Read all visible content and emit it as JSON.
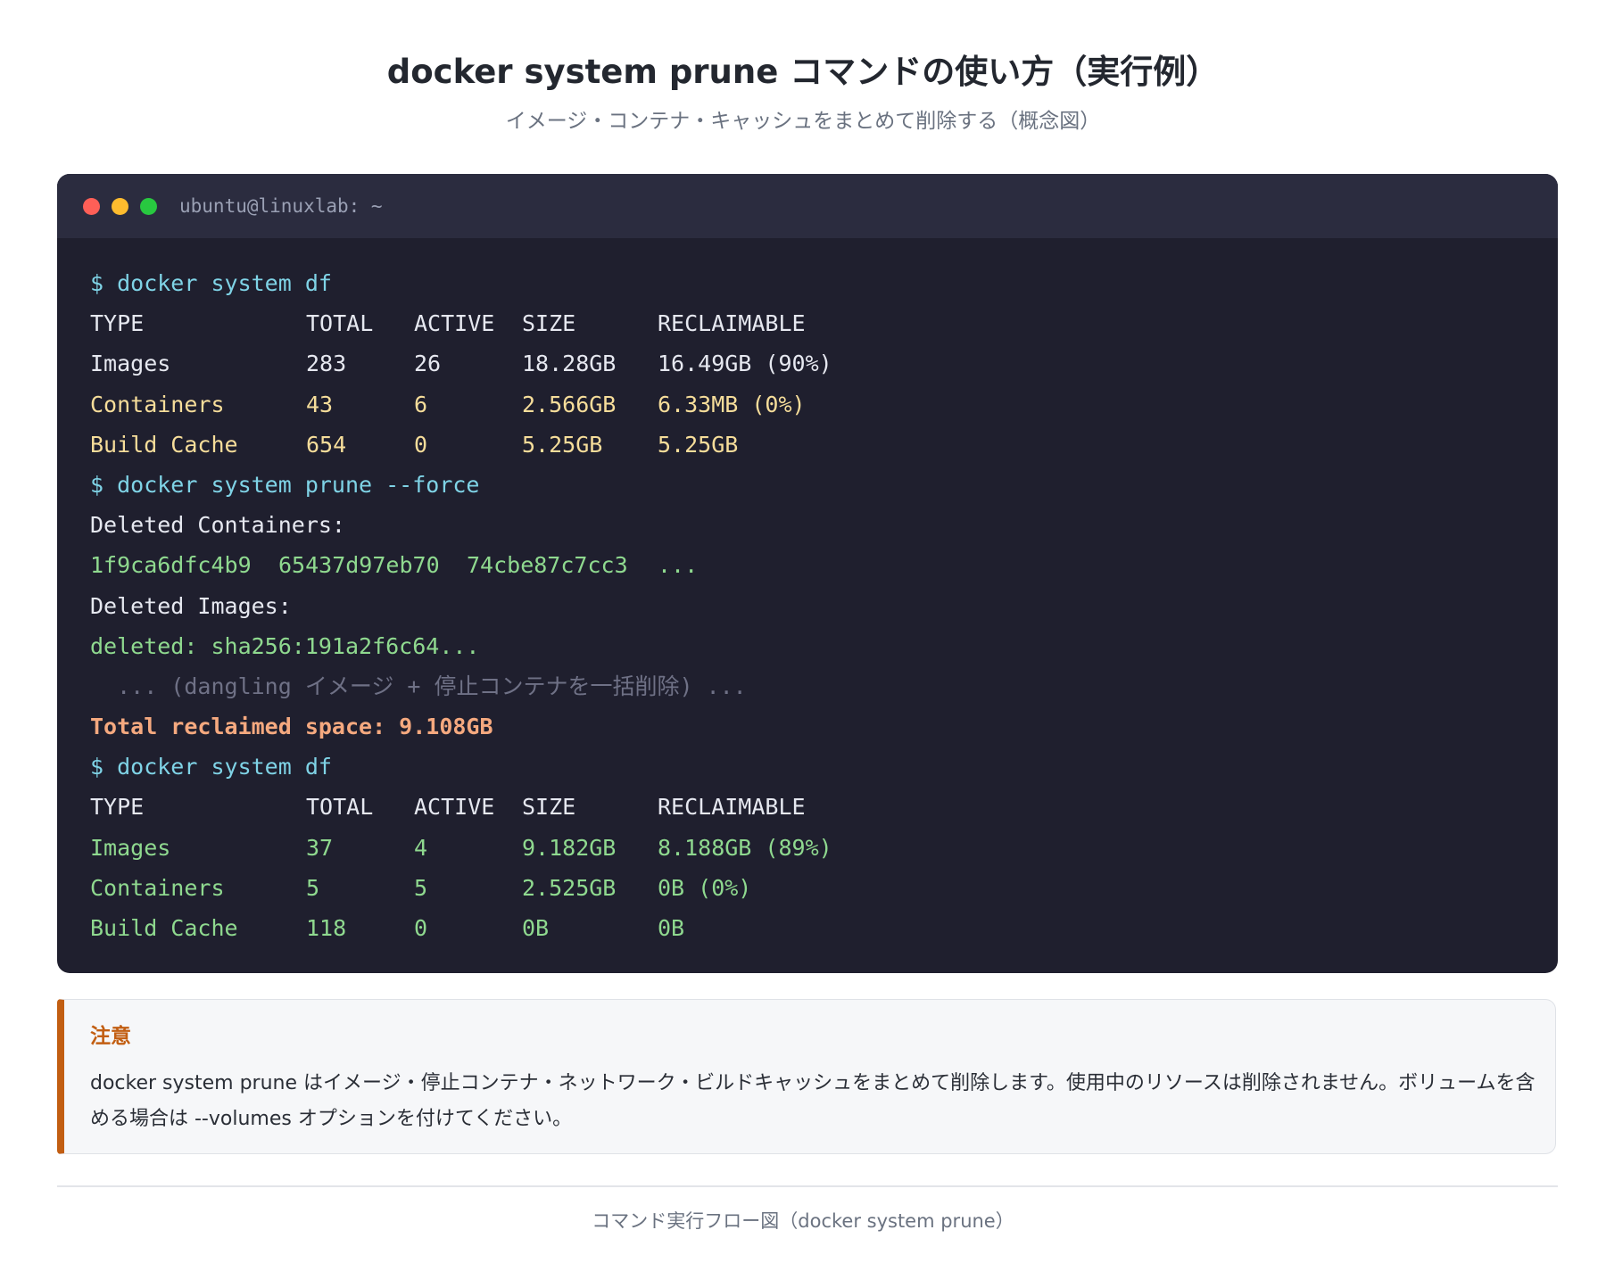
{
  "header": {
    "title": "docker system prune コマンドの使い方（実行例）",
    "subtitle": "イメージ・コンテナ・キャッシュをまとめて削除する（概念図）"
  },
  "terminal": {
    "window_title": "ubuntu@linuxlab: ~",
    "colors": {
      "background": "#1f1f2e",
      "titlebar": "#2b2c3f",
      "command": "#7fd3e6",
      "warning_rows": "#f6dd9a",
      "ok_rows": "#8fd98f",
      "total": "#f5a97f"
    },
    "command1": "$ docker system df",
    "df_before": {
      "headers": [
        "TYPE",
        "TOTAL",
        "ACTIVE",
        "SIZE",
        "RECLAIMABLE"
      ],
      "rows": [
        [
          "Images",
          "283",
          "26",
          "18.28GB",
          "16.49GB (90%)"
        ],
        [
          "Containers",
          "43",
          "6",
          "2.566GB",
          "6.33MB (0%)"
        ],
        [
          "Build Cache",
          "654",
          "0",
          "5.25GB",
          "5.25GB"
        ]
      ]
    },
    "command2": "$ docker system prune --force",
    "deleted_containers_label": "Deleted Containers:",
    "deleted_container_ids": [
      "1f9ca6dfc4b9",
      "65437d97eb70",
      "74cbe87c7cc3",
      "..."
    ],
    "deleted_images_label": "Deleted Images:",
    "deleted_image_line": "deleted: sha256:191a2f6c64...",
    "ellipsis_note": "  ... (dangling イメージ + 停止コンテナを一括削除) ...",
    "total_reclaimed": "Total reclaimed space: 9.108GB",
    "command3": "$ docker system df",
    "df_after": {
      "headers": [
        "TYPE",
        "TOTAL",
        "ACTIVE",
        "SIZE",
        "RECLAIMABLE"
      ],
      "rows": [
        [
          "Images",
          "37",
          "4",
          "9.182GB",
          "8.188GB (89%)"
        ],
        [
          "Containers",
          "5",
          "5",
          "2.525GB",
          "0B (0%)"
        ],
        [
          "Build Cache",
          "118",
          "0",
          "0B",
          "0B"
        ]
      ]
    }
  },
  "note": {
    "title": "注意",
    "text": "docker system prune はイメージ・停止コンテナ・ネットワーク・ビルドキャッシュをまとめて削除します。使用中のリソースは削除されません。ボリュームを含める場合は --volumes オプションを付けてください。",
    "accent_color": "#c25e12"
  },
  "footer": {
    "caption": "コマンド実行フロー図（docker system prune）"
  }
}
